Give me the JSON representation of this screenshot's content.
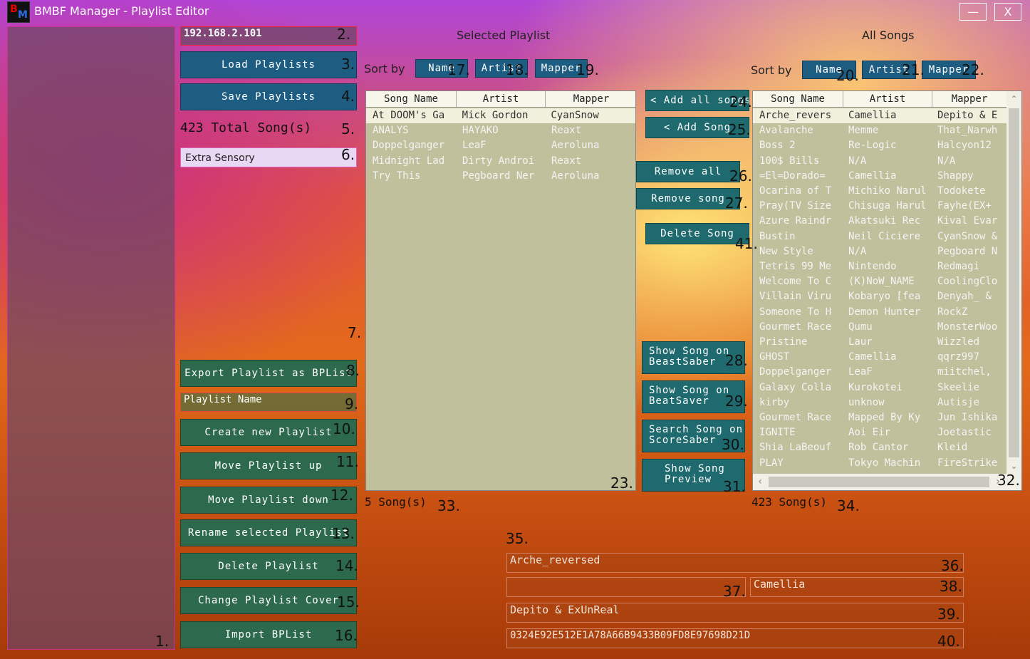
{
  "window": {
    "title": "BMBF Manager - Playlist Editor",
    "minimize_label": "—",
    "close_label": "X"
  },
  "left": {
    "ip_address": "192.168.2.101",
    "load_playlists": "Load Playlists",
    "save_playlists": "Save Playlists",
    "total_songs": "423 Total Song(s)",
    "selected_playlist": "Extra Sensory",
    "export_bplist": "Export Playlist as BPList",
    "playlist_name_placeholder": "Playlist Name",
    "create_playlist": "Create new Playlist",
    "move_up": "Move Playlist up",
    "move_down": "Move Playlist down",
    "rename_playlist": "Rename selected Playlist",
    "delete_playlist": "Delete Playlist",
    "change_cover": "Change Playlist Cover",
    "import_bplist": "Import BPList"
  },
  "selected_playlist": {
    "header": "Selected Playlist",
    "sort_by": "Sort by",
    "sort_name": "Name",
    "sort_artist": "Artist",
    "sort_mapper": "Mapper",
    "columns": [
      "Song Name",
      "Artist",
      "Mapper"
    ],
    "rows": [
      [
        "At DOOM's Ga",
        "Mick Gordon",
        "CyanSnow"
      ],
      [
        "ANALYS",
        "HAYAKO",
        "Reaxt"
      ],
      [
        "Doppelganger",
        "LeaF",
        "Aeroluna"
      ],
      [
        "Midnight Lad",
        "Dirty Androi",
        "Reaxt"
      ],
      [
        "Try This",
        "Pegboard Ner",
        "Aeroluna"
      ]
    ],
    "count": "5 Song(s)"
  },
  "middle": {
    "add_all": "< Add all songs",
    "add_song": "< Add Song",
    "remove_all": "Remove all",
    "remove_song": "Remove song",
    "delete_song": "Delete Song",
    "beastsaber_l1": "Show Song on",
    "beastsaber_l2": "BeastSaber",
    "beatsaver_l1": "Show Song on",
    "beatsaver_l2": "BeatSaver",
    "scoresaber_l1": "Search Song on",
    "scoresaber_l2": "ScoreSaber",
    "preview_l1": "Show Song",
    "preview_l2": "Preview"
  },
  "all_songs": {
    "header": "All Songs",
    "sort_by": "Sort by",
    "sort_name": "Name",
    "sort_artist": "Artist",
    "sort_mapper": "Mapper",
    "columns": [
      "Song Name",
      "Artist",
      "Mapper"
    ],
    "rows": [
      [
        "Arche_revers",
        "Camellia",
        "Depito & E"
      ],
      [
        "Avalanche",
        "Memme",
        "That_Narwh"
      ],
      [
        "Boss 2",
        "Re-Logic",
        "Halcyon12"
      ],
      [
        "100$ Bills",
        "N/A",
        "N/A"
      ],
      [
        "=El=Dorado=",
        "Camellia",
        "Shappy"
      ],
      [
        "Ocarina of T",
        "Michiko Narul",
        "Todokete"
      ],
      [
        "Pray(TV Size",
        "Chisuga Harul",
        "Fayhe(EX+"
      ],
      [
        "Azure Raindr",
        "Akatsuki Rec",
        "Kival Evar"
      ],
      [
        "Bustin",
        "Neil Ciciere",
        "CyanSnow &"
      ],
      [
        "New Style",
        "N/A",
        "Pegboard N"
      ],
      [
        "Tetris 99 Me",
        "Nintendo",
        "Redmagi"
      ],
      [
        "Welcome To C",
        "(K)NoW_NAME",
        "CoolingClo"
      ],
      [
        "Villain Viru",
        "Kobaryo [fea",
        "Denyah_ &"
      ],
      [
        "Someone To H",
        "Demon Hunter",
        "RockZ"
      ],
      [
        "Gourmet Race",
        "Qumu",
        "MonsterWoo"
      ],
      [
        "Pristine",
        "Laur",
        "Wizzled"
      ],
      [
        "GHOST",
        "Camellia",
        "qqrz997"
      ],
      [
        "Doppelganger",
        "LeaF",
        "miitchel,"
      ],
      [
        "Galaxy Colla",
        "Kurokotei",
        "Skeelie"
      ],
      [
        "kirby",
        "unknow",
        "Autisje"
      ],
      [
        "Gourmet Race",
        "Mapped By Ky",
        "Jun Ishika"
      ],
      [
        "IGNITE",
        "Aoi Eir",
        "Joetastic"
      ],
      [
        "Shia LaBeouf",
        "Rob Cantor",
        "Kleid"
      ],
      [
        "PLAY",
        "Tokyo Machin",
        "FireStrike"
      ]
    ],
    "count": "423 Song(s)"
  },
  "details": {
    "song_name": "Arche_reversed",
    "sub_name": "",
    "artist": "Camellia",
    "mapper": "Depito & ExUnReal",
    "hash": "0324E92E512E1A78A66B9433B09FD8E97698D21D"
  },
  "markers": [
    "1.",
    "2.",
    "3.",
    "4.",
    "5.",
    "6.",
    "7.",
    "8.",
    "9.",
    "10.",
    "11.",
    "12.",
    "13.",
    "14.",
    "15.",
    "16.",
    "17.",
    "18.",
    "19.",
    "20.",
    "21.",
    "22.",
    "23.",
    "24.",
    "25.",
    "26.",
    "27.",
    "28.",
    "29.",
    "30.",
    "31.",
    "32.",
    "33.",
    "34.",
    "35.",
    "36.",
    "37.",
    "38.",
    "39.",
    "40.",
    "41."
  ]
}
